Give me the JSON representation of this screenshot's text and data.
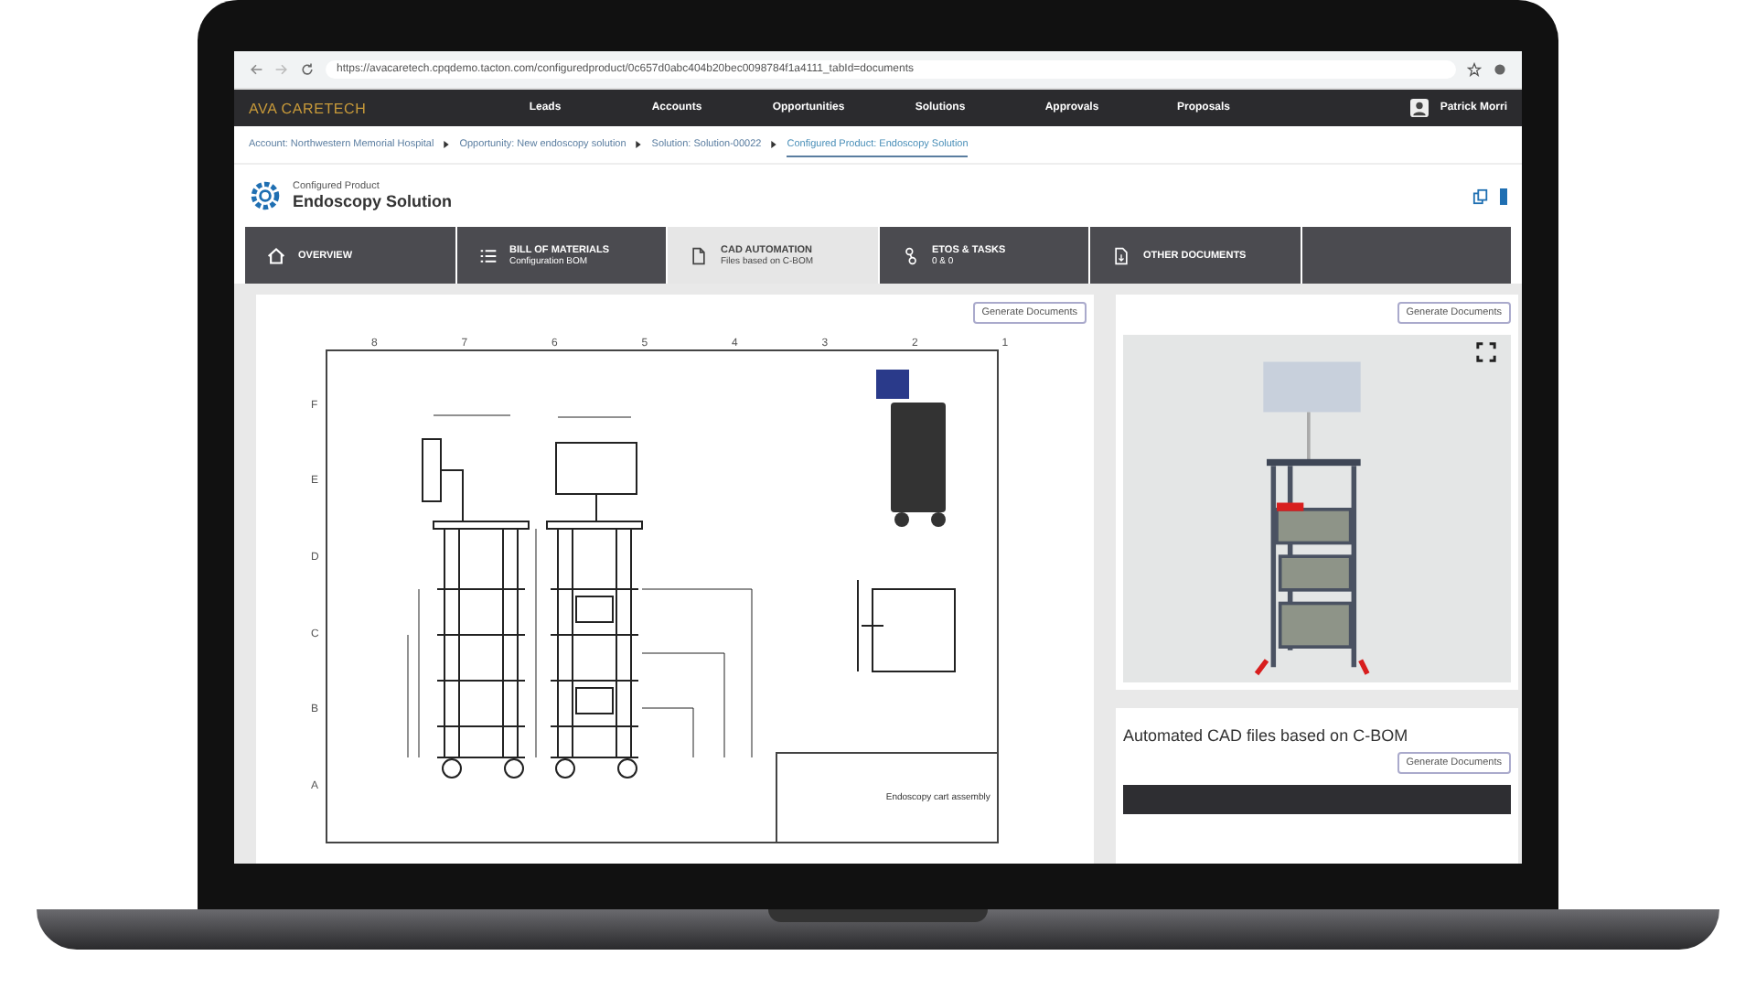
{
  "browser": {
    "url": "https://avacaretech.cpqdemo.tacton.com/configuredproduct/0c657d0abc404b20bec0098784f1a4111_tabId=documents"
  },
  "nav": {
    "logo": "AVA CARETECH",
    "items": [
      "Leads",
      "Accounts",
      "Opportunities",
      "Solutions",
      "Approvals",
      "Proposals"
    ],
    "user": "Patrick Morri"
  },
  "breadcrumbs": [
    {
      "label": "Account:",
      "value": "Northwestern Memorial Hospital",
      "selected": false
    },
    {
      "label": "Opportunity:",
      "value": "New endoscopy solution",
      "selected": false
    },
    {
      "label": "Solution:",
      "value": "Solution-00022",
      "selected": false
    },
    {
      "label": "Configured Product:",
      "value": "Endoscopy Solution",
      "selected": true
    }
  ],
  "header": {
    "overline": "Configured Product",
    "title": "Endoscopy Solution"
  },
  "tabs": [
    {
      "kind": "home",
      "title": "OVERVIEW",
      "selected": false
    },
    {
      "kind": "list",
      "title": "BILL OF MATERIALS",
      "subtitle": "Configuration BOM",
      "selected": false
    },
    {
      "kind": "file",
      "title": "CAD AUTOMATION",
      "subtitle": "Files based on C-BOM",
      "selected": true
    },
    {
      "kind": "tasks",
      "title": "ETOS & TASKS",
      "subtitle": "0 & 0",
      "selected": false
    },
    {
      "kind": "doc",
      "title": "OTHER DOCUMENTS",
      "selected": false
    },
    {
      "kind": "empty",
      "selected": false
    }
  ],
  "drawing_panel": {
    "button": "Generate Documents",
    "columns": [
      "8",
      "7",
      "6",
      "5",
      "4",
      "3",
      "2",
      "1"
    ],
    "rows": [
      "F",
      "E",
      "D",
      "C",
      "B",
      "A"
    ],
    "title_block": "Endoscopy cart assembly"
  },
  "viewer_panel": {
    "button": "Generate Documents"
  },
  "files_panel": {
    "title": "Automated CAD files based on C-BOM",
    "button": "Generate Documents"
  }
}
